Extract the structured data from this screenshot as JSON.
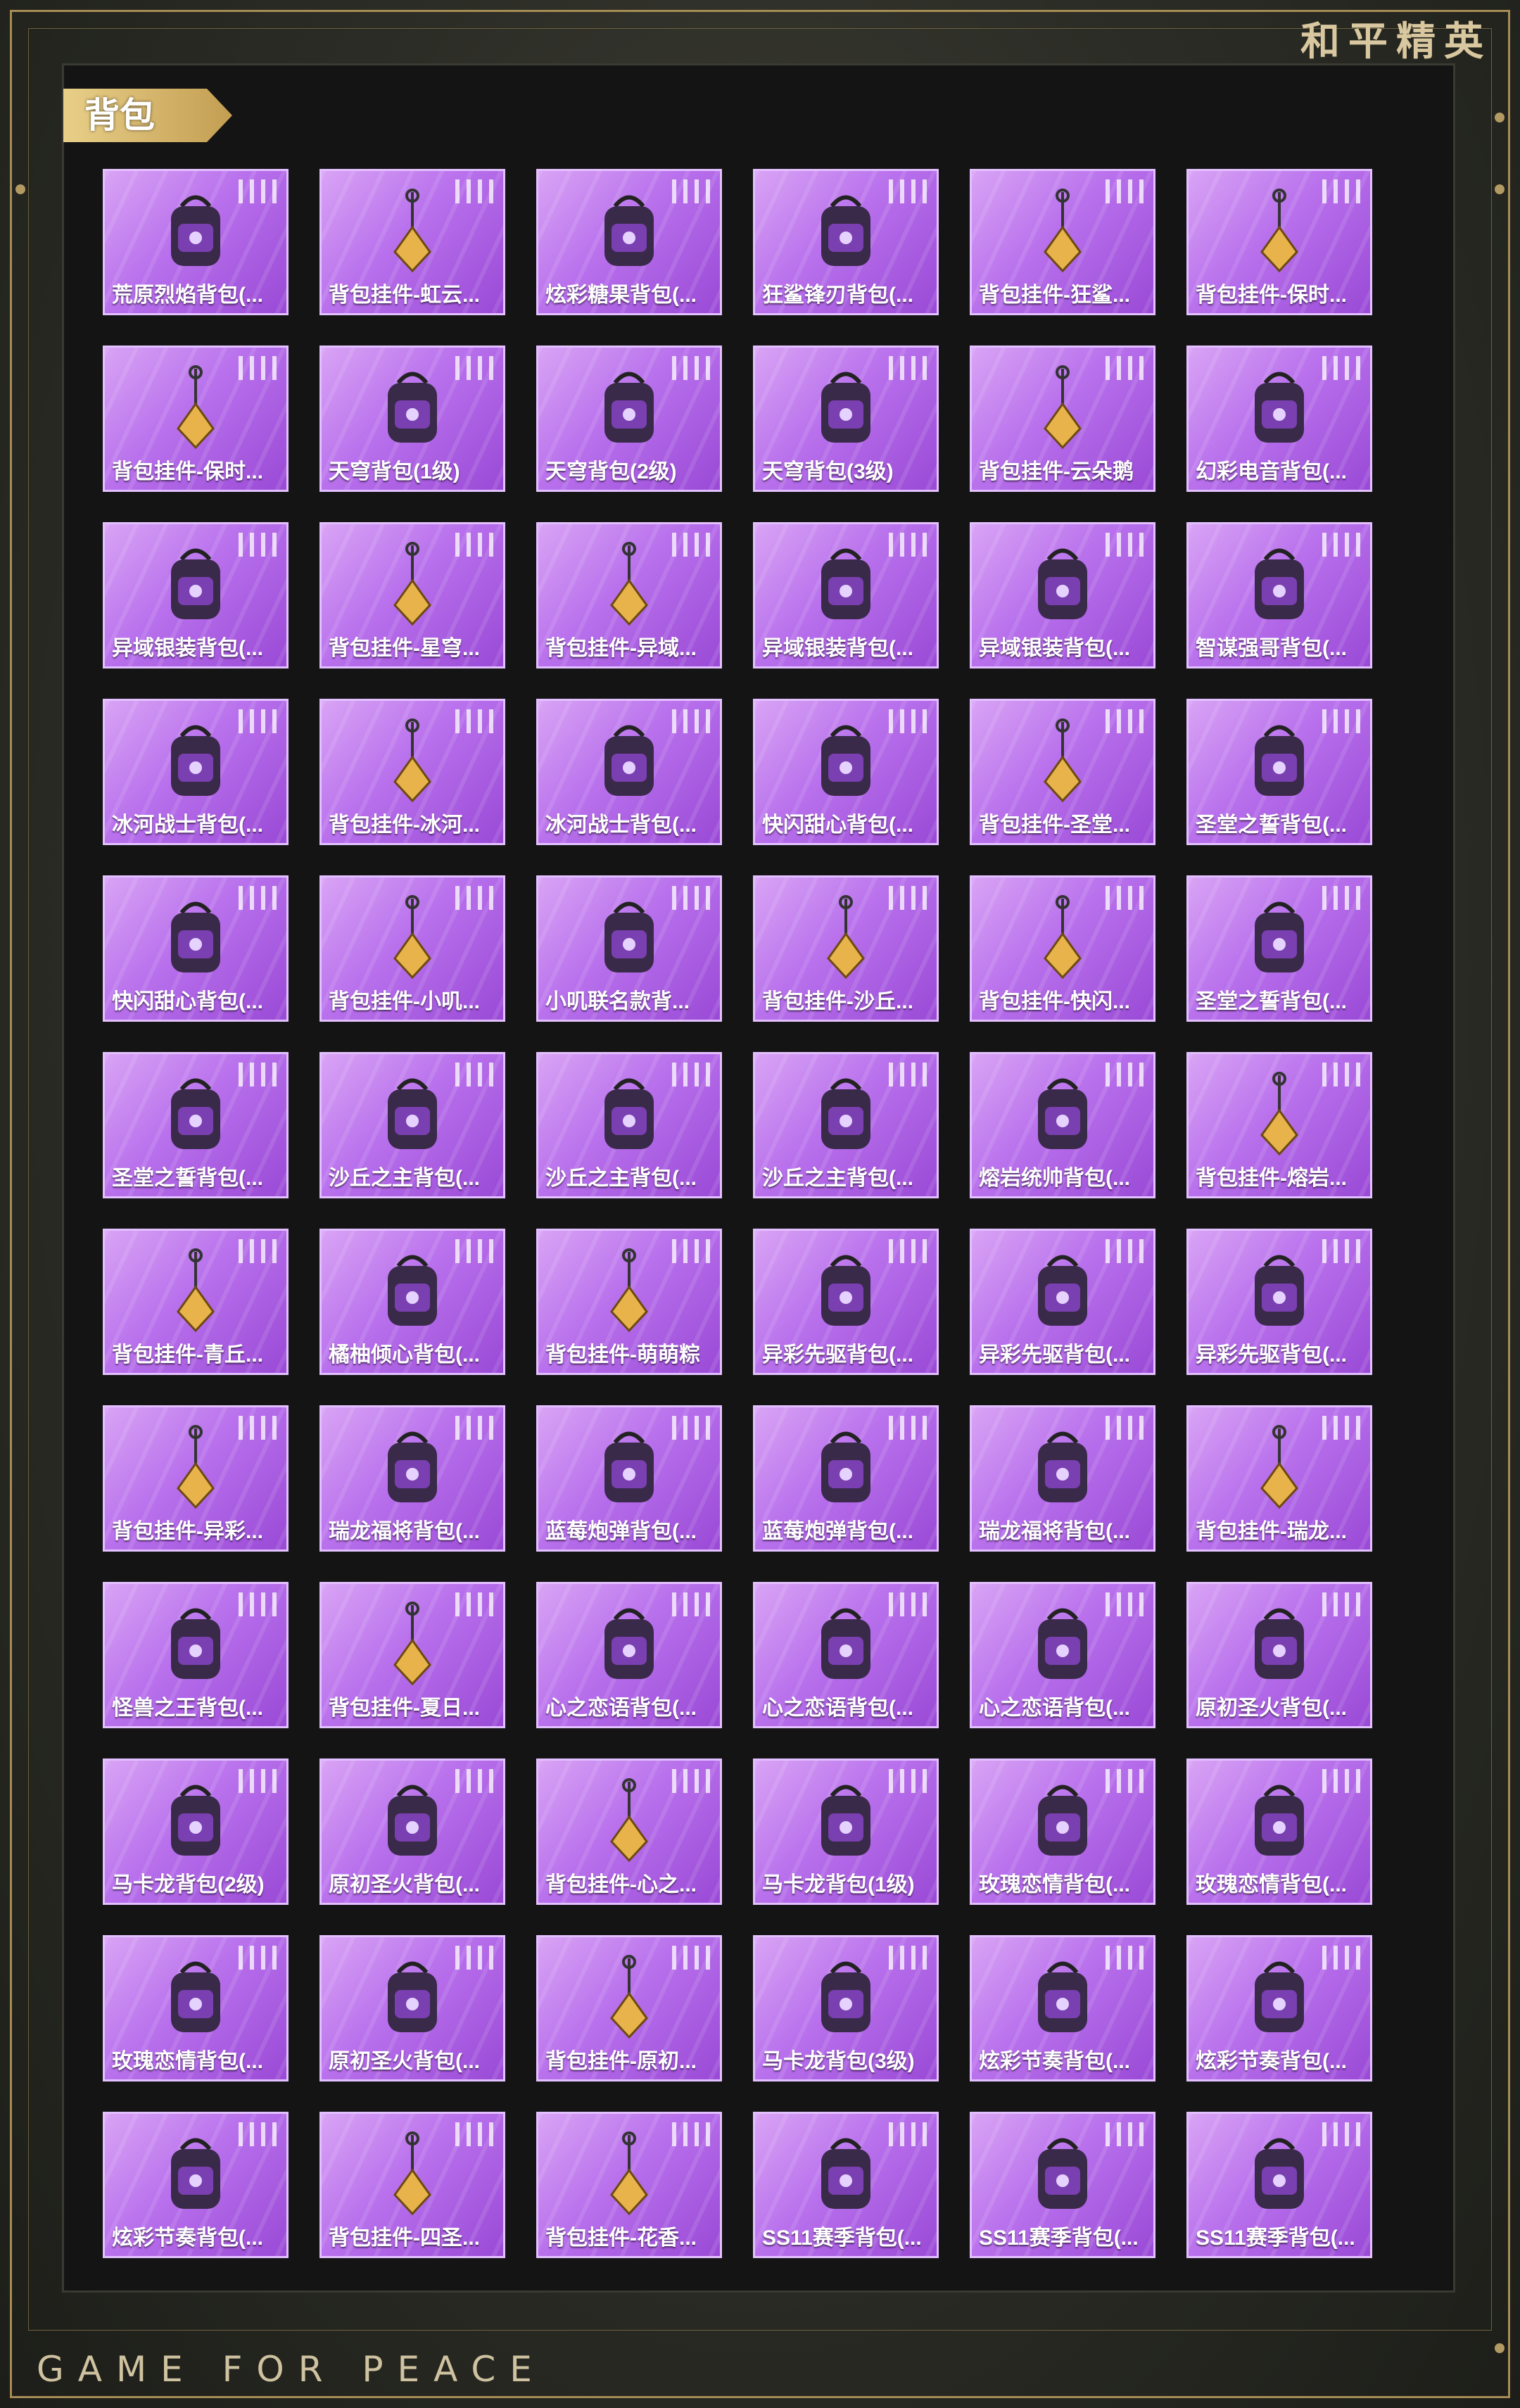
{
  "header": {
    "brand": "和平精英"
  },
  "section": {
    "title": "背包"
  },
  "footer": {
    "text": "GAME FOR PEACE"
  },
  "items": [
    {
      "label": "荒原烈焰背包(..."
    },
    {
      "label": "背包挂件-虹云..."
    },
    {
      "label": "炫彩糖果背包(..."
    },
    {
      "label": "狂鲨锋刃背包(..."
    },
    {
      "label": "背包挂件-狂鲨..."
    },
    {
      "label": "背包挂件-保时..."
    },
    {
      "label": "背包挂件-保时..."
    },
    {
      "label": "天穹背包(1级)"
    },
    {
      "label": "天穹背包(2级)"
    },
    {
      "label": "天穹背包(3级)"
    },
    {
      "label": "背包挂件-云朵鹅"
    },
    {
      "label": "幻彩电音背包(..."
    },
    {
      "label": "异域银装背包(..."
    },
    {
      "label": "背包挂件-星穹..."
    },
    {
      "label": "背包挂件-异域..."
    },
    {
      "label": "异域银装背包(..."
    },
    {
      "label": "异域银装背包(..."
    },
    {
      "label": "智谋强哥背包(..."
    },
    {
      "label": "冰河战士背包(..."
    },
    {
      "label": "背包挂件-冰河..."
    },
    {
      "label": "冰河战士背包(..."
    },
    {
      "label": "快闪甜心背包(..."
    },
    {
      "label": "背包挂件-圣堂..."
    },
    {
      "label": "圣堂之誓背包(..."
    },
    {
      "label": "快闪甜心背包(..."
    },
    {
      "label": "背包挂件-小叽..."
    },
    {
      "label": "小叽联名款背..."
    },
    {
      "label": "背包挂件-沙丘..."
    },
    {
      "label": "背包挂件-快闪..."
    },
    {
      "label": "圣堂之誓背包(..."
    },
    {
      "label": "圣堂之誓背包(..."
    },
    {
      "label": "沙丘之主背包(..."
    },
    {
      "label": "沙丘之主背包(..."
    },
    {
      "label": "沙丘之主背包(..."
    },
    {
      "label": "熔岩统帅背包(..."
    },
    {
      "label": "背包挂件-熔岩..."
    },
    {
      "label": "背包挂件-青丘..."
    },
    {
      "label": "橘柚倾心背包(..."
    },
    {
      "label": "背包挂件-萌萌粽"
    },
    {
      "label": "异彩先驱背包(..."
    },
    {
      "label": "异彩先驱背包(..."
    },
    {
      "label": "异彩先驱背包(..."
    },
    {
      "label": "背包挂件-异彩..."
    },
    {
      "label": "瑞龙福将背包(..."
    },
    {
      "label": "蓝莓炮弹背包(..."
    },
    {
      "label": "蓝莓炮弹背包(..."
    },
    {
      "label": "瑞龙福将背包(..."
    },
    {
      "label": "背包挂件-瑞龙..."
    },
    {
      "label": "怪兽之王背包(..."
    },
    {
      "label": "背包挂件-夏日..."
    },
    {
      "label": "心之恋语背包(..."
    },
    {
      "label": "心之恋语背包(..."
    },
    {
      "label": "心之恋语背包(..."
    },
    {
      "label": "原初圣火背包(..."
    },
    {
      "label": "马卡龙背包(2级)"
    },
    {
      "label": "原初圣火背包(..."
    },
    {
      "label": "背包挂件-心之..."
    },
    {
      "label": "马卡龙背包(1级)"
    },
    {
      "label": "玫瑰恋情背包(..."
    },
    {
      "label": "玫瑰恋情背包(..."
    },
    {
      "label": "玫瑰恋情背包(..."
    },
    {
      "label": "原初圣火背包(..."
    },
    {
      "label": "背包挂件-原初..."
    },
    {
      "label": "马卡龙背包(3级)"
    },
    {
      "label": "炫彩节奏背包(..."
    },
    {
      "label": "炫彩节奏背包(..."
    },
    {
      "label": "炫彩节奏背包(..."
    },
    {
      "label": "背包挂件-四圣..."
    },
    {
      "label": "背包挂件-花香..."
    },
    {
      "label": "SS11赛季背包(..."
    },
    {
      "label": "SS11赛季背包(..."
    },
    {
      "label": "SS11赛季背包(..."
    }
  ]
}
